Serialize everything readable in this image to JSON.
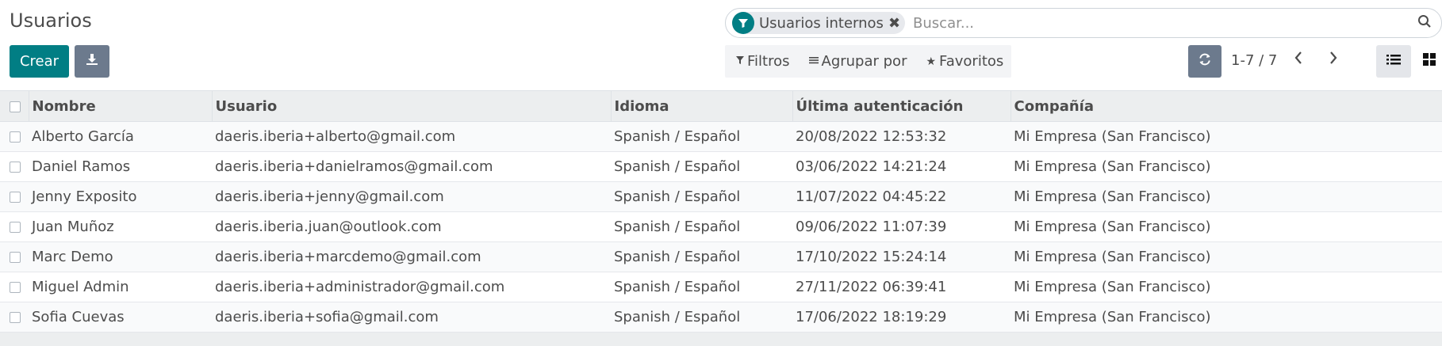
{
  "page": {
    "title": "Usuarios"
  },
  "search": {
    "facet_label": "Usuarios internos",
    "placeholder": "Buscar..."
  },
  "toolbar": {
    "create_label": "Crear",
    "filters_label": "Filtros",
    "group_label": "Agrupar por",
    "favorites_label": "Favoritos",
    "pager_text": "1-7 / 7"
  },
  "table": {
    "headers": [
      "Nombre",
      "Usuario",
      "Idioma",
      "Última autenticación",
      "Compañía"
    ],
    "rows": [
      {
        "nombre": "Alberto García",
        "usuario": "daeris.iberia+alberto@gmail.com",
        "idioma": "Spanish / Español",
        "ultima": "20/08/2022 12:53:32",
        "compania": "Mi Empresa (San Francisco)"
      },
      {
        "nombre": "Daniel Ramos",
        "usuario": "daeris.iberia+danielramos@gmail.com",
        "idioma": "Spanish / Español",
        "ultima": "03/06/2022 14:21:24",
        "compania": "Mi Empresa (San Francisco)"
      },
      {
        "nombre": "Jenny Exposito",
        "usuario": "daeris.iberia+jenny@gmail.com",
        "idioma": "Spanish / Español",
        "ultima": "11/07/2022 04:45:22",
        "compania": "Mi Empresa (San Francisco)"
      },
      {
        "nombre": "Juan Muñoz",
        "usuario": "daeris.iberia.juan@outlook.com",
        "idioma": "Spanish / Español",
        "ultima": "09/06/2022 11:07:39",
        "compania": "Mi Empresa (San Francisco)"
      },
      {
        "nombre": "Marc Demo",
        "usuario": "daeris.iberia+marcdemo@gmail.com",
        "idioma": "Spanish / Español",
        "ultima": "17/10/2022 15:24:14",
        "compania": "Mi Empresa (San Francisco)"
      },
      {
        "nombre": "Miguel Admin",
        "usuario": "daeris.iberia+administrador@gmail.com",
        "idioma": "Spanish / Español",
        "ultima": "27/11/2022 06:39:41",
        "compania": "Mi Empresa (San Francisco)"
      },
      {
        "nombre": "Sofia Cuevas",
        "usuario": "daeris.iberia+sofia@gmail.com",
        "idioma": "Spanish / Español",
        "ultima": "17/06/2022 18:19:29",
        "compania": "Mi Empresa (San Francisco)"
      }
    ]
  },
  "icons": {
    "facet": "filter-icon",
    "facet_remove": "close-icon",
    "search": "search-icon",
    "download": "download-icon",
    "filters": "funnel-icon",
    "group": "list-lines-icon",
    "favorites": "star-icon",
    "refresh": "refresh-icon",
    "prev": "chevron-left-icon",
    "next": "chevron-right-icon",
    "list_view": "list-view-icon",
    "kanban_view": "kanban-view-icon"
  },
  "colors": {
    "primary": "#017e84",
    "secondary": "#6c7a8d"
  }
}
